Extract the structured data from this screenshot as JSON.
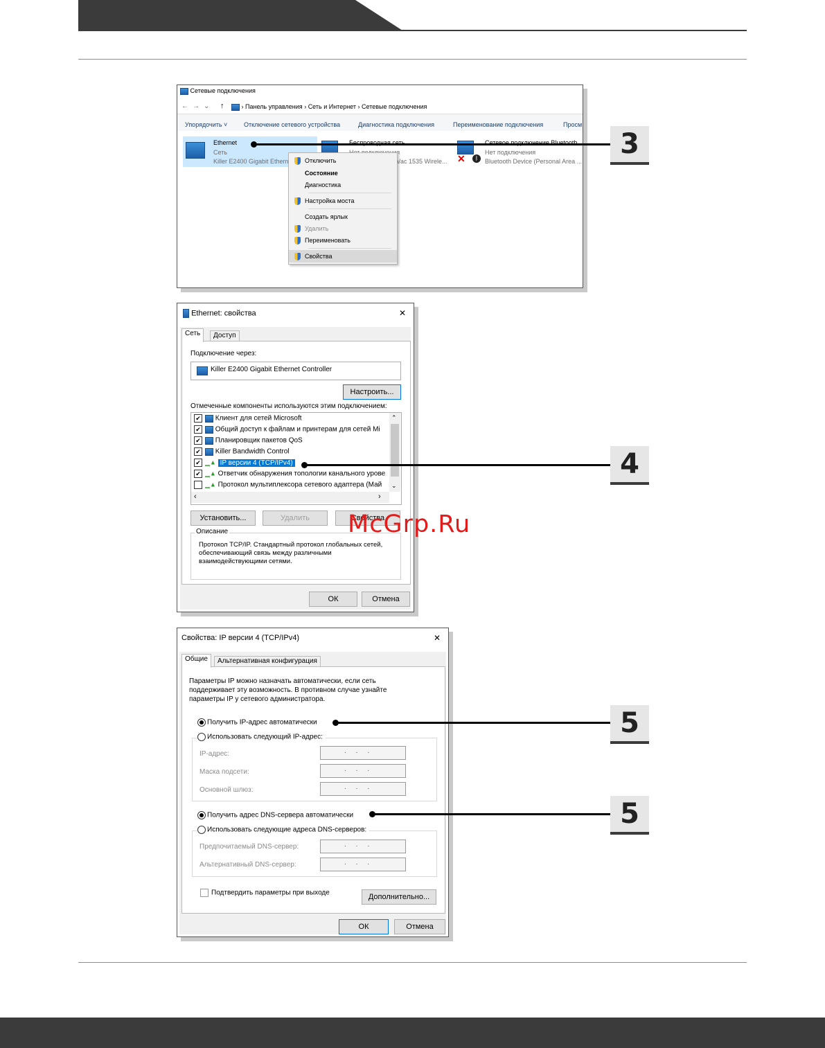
{
  "win1": {
    "title": "Сетевые подключения",
    "breadcrumb": [
      "Панель управления",
      "Сеть и Интернет",
      "Сетевые подключения"
    ],
    "toolbar": [
      "Упорядочить ˅",
      "Отключение сетевого устройства",
      "Диагностика подключения",
      "Переименование подключения",
      "Просм"
    ],
    "adapters": [
      {
        "name": "Ethernet",
        "status": "Сеть",
        "device": "Killer E2400 Gigabit Ethern"
      },
      {
        "name": "Беспроводная сеть",
        "status": "Нет подключения",
        "device": "/a/ac 1535 Wirele..."
      },
      {
        "name": "Сетевое подключение Bluetooth",
        "status": "Нет подключения",
        "device": "Bluetooth Device (Personal Area ..."
      }
    ],
    "menu": [
      "Отключить",
      "Состояние",
      "Диагностика",
      "Настройка моста",
      "Создать ярлык",
      "Удалить",
      "Переименовать",
      "Свойства"
    ]
  },
  "win2": {
    "title": "Ethernet: свойства",
    "close": "✕",
    "tabs": [
      "Сеть",
      "Доступ"
    ],
    "connect_label": "Подключение через:",
    "adapter": "Killer E2400 Gigabit Ethernet Controller",
    "configure": "Настроить...",
    "components_label": "Отмеченные компоненты используются этим подключением:",
    "components": [
      {
        "label": "Клиент для сетей Microsoft",
        "checked": true
      },
      {
        "label": "Общий доступ к файлам и принтерам для сетей Mi",
        "checked": true
      },
      {
        "label": "Планировщик пакетов QoS",
        "checked": true
      },
      {
        "label": "Killer Bandwidth Control",
        "checked": true
      },
      {
        "label": "IP версии 4 (TCP/IPv4)",
        "checked": true
      },
      {
        "label": "Ответчик обнаружения топологии канального урове",
        "checked": true
      },
      {
        "label": "Протокол мультиплексора сетевого адаптера (Май",
        "checked": false
      }
    ],
    "install": "Установить...",
    "remove": "Удалить",
    "properties": "Свойства",
    "description_label": "Описание",
    "description": "Протокол TCP/IP. Стандартный протокол глобальных сетей, обеспечивающий связь между различными взаимодействующими сетями.",
    "ok": "ОК",
    "cancel": "Отмена"
  },
  "win3": {
    "title": "Свойства: IP версии 4 (TCP/IPv4)",
    "close": "✕",
    "tabs": [
      "Общие",
      "Альтернативная конфигурация"
    ],
    "intro": "Параметры IP можно назначать автоматически, если сеть поддерживает эту возможность. В противном случае узнайте параметры IP у сетевого администратора.",
    "auto_ip": "Получить IP-адрес автоматически",
    "manual_ip": "Использовать следующий IP-адрес:",
    "ip_label": "IP-адрес:",
    "mask_label": "Маска подсети:",
    "gateway_label": "Основной шлюз:",
    "auto_dns": "Получить адрес DNS-сервера автоматически",
    "manual_dns": "Использовать следующие адреса DNS-серверов:",
    "pref_dns": "Предпочитаемый DNS-сервер:",
    "alt_dns": "Альтернативный DNS-сервер:",
    "ip_placeholder": ".     .     .",
    "validate": "Подтвердить параметры при выходе",
    "advanced": "Дополнительно...",
    "ok": "ОК",
    "cancel": "Отмена"
  },
  "callouts": [
    "3",
    "4",
    "5",
    "5"
  ],
  "watermark": "McGrp.Ru"
}
